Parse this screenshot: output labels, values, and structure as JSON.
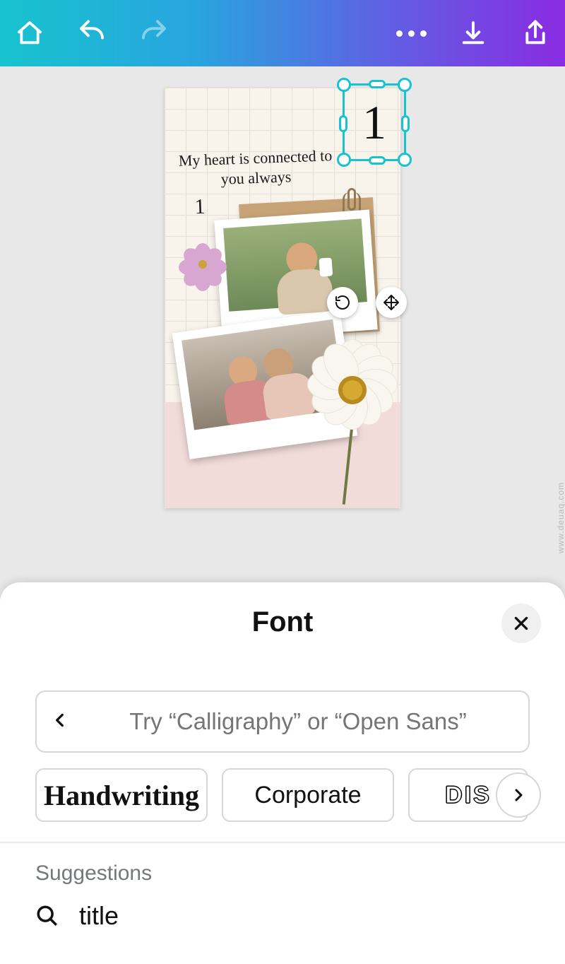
{
  "toolbar": {
    "home": "home-icon",
    "undo": "undo-icon",
    "redo": "redo-icon",
    "more": "more-icon",
    "download": "download-icon",
    "share": "share-icon"
  },
  "canvas": {
    "script_line": "My heart is connected to you always",
    "script_small": "1",
    "selected_text": "1",
    "rotate_tool": "rotate-icon",
    "move_tool": "move-icon"
  },
  "sheet": {
    "title": "Font",
    "close": "close-icon",
    "search": {
      "placeholder": "Try “Calligraphy” or “Open Sans”",
      "back": "chevron-left-icon"
    },
    "categories": [
      {
        "id": "handwriting",
        "label": "Handwriting"
      },
      {
        "id": "corporate",
        "label": "Corporate"
      },
      {
        "id": "display",
        "label": "DIS"
      }
    ],
    "scroll_next": "chevron-right-icon",
    "suggestions_header": "Suggestions",
    "suggestions": [
      {
        "icon": "search-icon",
        "label": "title"
      }
    ]
  },
  "watermark": "www.deuaq.com",
  "colors": {
    "gradient_start": "#17c3ce",
    "gradient_end": "#8a2be2",
    "selection": "#17c3ce",
    "arrow": "#ff0000"
  }
}
